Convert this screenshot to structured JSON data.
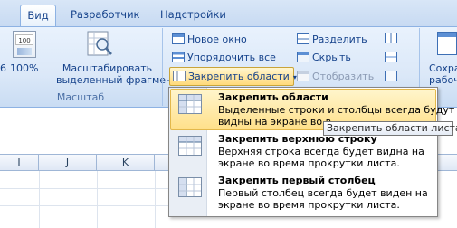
{
  "tabs": [
    {
      "label": "Вид",
      "active": true
    },
    {
      "label": "Разработчик",
      "active": false
    },
    {
      "label": "Надстройки",
      "active": false
    }
  ],
  "zoom_group": {
    "left_partial": "6",
    "zoom100_label": "100%",
    "zoom100_icon_text": "100",
    "zoom_selection_label_line1": "Масштабировать",
    "zoom_selection_label_line2": "выделенный фрагмент",
    "group_label": "Масштаб"
  },
  "window_group": {
    "new_window": "Новое окно",
    "arrange_all": "Упорядочить все",
    "freeze_panes": "Закрепить области",
    "split": "Разделить",
    "hide": "Скрыть",
    "unhide": "Отобразить",
    "save_workspace_line1": "Сохра",
    "save_workspace_line2": "рабочую"
  },
  "columns": [
    "I",
    "J",
    "K"
  ],
  "menu": {
    "items": [
      {
        "title": "Закрепить области",
        "desc_line1": "Выделенные строки и столбцы всегда будут",
        "desc_line2": "видны на экране во в",
        "highlighted": true
      },
      {
        "title": "Закрепить верхнюю строку",
        "desc_line1": "Верхняя строка всегда будет видна на",
        "desc_line2": "экране во время прокрутки листа.",
        "highlighted": false
      },
      {
        "title": "Закрепить первый столбец",
        "desc_line1": "Первый столбец всегда будет виден на",
        "desc_line2": "экране во время прокрутки листа.",
        "highlighted": false
      }
    ]
  },
  "tooltip": "Закрепить области листа",
  "colors": {
    "ribbon_text": "#15428b",
    "highlight": "#ffe08a",
    "highlight_border": "#e3b84b"
  }
}
